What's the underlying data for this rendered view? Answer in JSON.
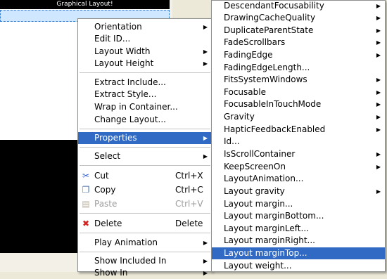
{
  "device": {
    "title": "Graphical Layout!"
  },
  "context_menu": {
    "items": [
      {
        "label": "Orientation",
        "submenu": true
      },
      {
        "label": "Edit ID...",
        "submenu": false
      },
      {
        "label": "Layout Width",
        "submenu": true
      },
      {
        "label": "Layout Height",
        "submenu": true
      },
      {
        "label": "Extract Include...",
        "submenu": false
      },
      {
        "label": "Extract Style...",
        "submenu": false
      },
      {
        "label": "Wrap in Container...",
        "submenu": false
      },
      {
        "label": "Change Layout...",
        "submenu": false
      },
      {
        "label": "Properties",
        "submenu": true,
        "highlighted": true
      },
      {
        "label": "Select",
        "submenu": true
      },
      {
        "label": "Cut",
        "shortcut": "Ctrl+X",
        "icon": "scissors-icon"
      },
      {
        "label": "Copy",
        "shortcut": "Ctrl+C",
        "icon": "copy-icon"
      },
      {
        "label": "Paste",
        "shortcut": "Ctrl+V",
        "icon": "paste-icon",
        "disabled": true
      },
      {
        "label": "Delete",
        "shortcut": "Delete",
        "icon": "delete-x-icon"
      },
      {
        "label": "Play Animation",
        "submenu": true
      },
      {
        "label": "Show Included In",
        "submenu": true
      },
      {
        "label": "Show In",
        "submenu": true
      }
    ]
  },
  "properties_submenu": {
    "items": [
      {
        "label": "DescendantFocusability",
        "submenu": true
      },
      {
        "label": "DrawingCacheQuality",
        "submenu": true
      },
      {
        "label": "DuplicateParentState",
        "submenu": true
      },
      {
        "label": "FadeScrollbars",
        "submenu": true
      },
      {
        "label": "FadingEdge",
        "submenu": true
      },
      {
        "label": "FadingEdgeLength...",
        "submenu": false
      },
      {
        "label": "FitsSystemWindows",
        "submenu": true
      },
      {
        "label": "Focusable",
        "submenu": true
      },
      {
        "label": "FocusableInTouchMode",
        "submenu": true
      },
      {
        "label": "Gravity",
        "submenu": true
      },
      {
        "label": "HapticFeedbackEnabled",
        "submenu": true
      },
      {
        "label": "Id...",
        "submenu": false
      },
      {
        "label": "IsScrollContainer",
        "submenu": true
      },
      {
        "label": "KeepScreenOn",
        "submenu": true
      },
      {
        "label": "LayoutAnimation...",
        "submenu": false
      },
      {
        "label": "Layout gravity",
        "submenu": true
      },
      {
        "label": "Layout margin...",
        "submenu": false
      },
      {
        "label": "Layout marginBottom...",
        "submenu": false
      },
      {
        "label": "Layout marginLeft...",
        "submenu": false
      },
      {
        "label": "Layout marginRight...",
        "submenu": false
      },
      {
        "label": "Layout marginTop...",
        "submenu": false,
        "highlighted": true
      },
      {
        "label": "Layout weight...",
        "submenu": false
      }
    ]
  }
}
